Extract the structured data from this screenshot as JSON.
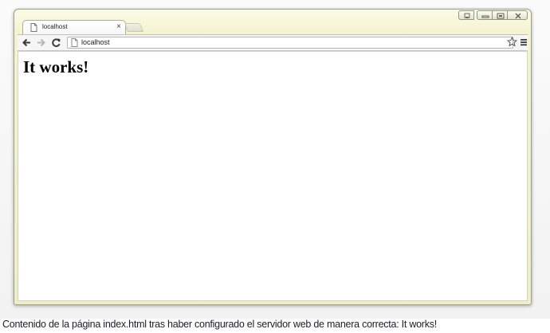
{
  "tab": {
    "title": "localhost",
    "close_glyph": "×"
  },
  "toolbar": {
    "url": "localhost",
    "back_icon": "back-arrow-icon",
    "forward_icon": "forward-arrow-icon",
    "reload_icon": "reload-icon",
    "bookmark_icon": "star-icon",
    "menu_icon": "hamburger-menu-icon"
  },
  "window_controls": [
    "user-icon",
    "minimize-icon",
    "maximize-icon",
    "close-icon"
  ],
  "page": {
    "heading": "It works!"
  },
  "caption": "Contenido de la página index.html tras haber configurado el servidor web de manera correcta: It works!",
  "colors": {
    "frame": "#f4f3d0",
    "content_bg": "#ffffff"
  }
}
